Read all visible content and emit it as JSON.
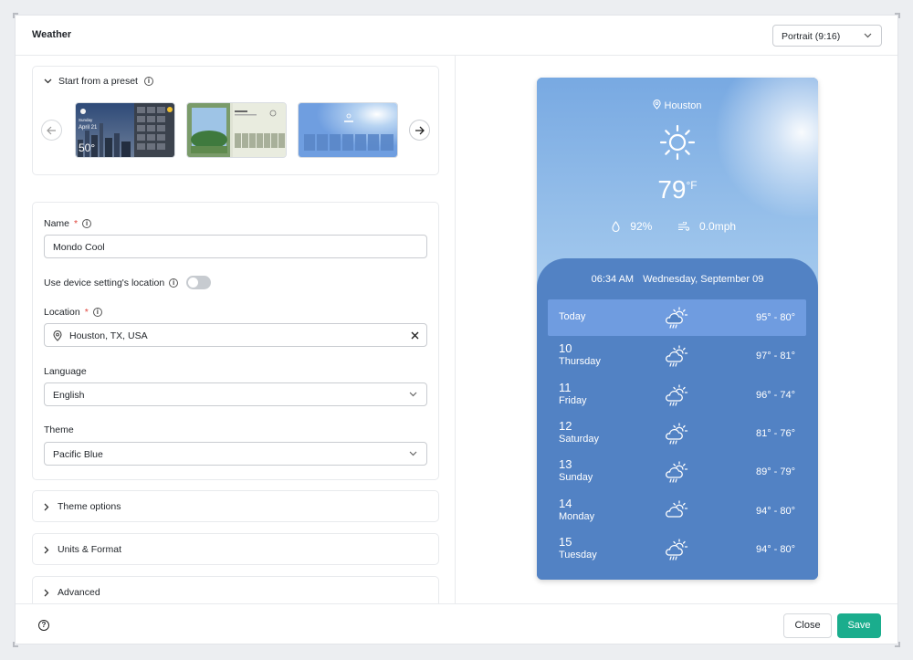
{
  "header": {
    "title": "Weather",
    "orientation": "Portrait (9:16)"
  },
  "preset": {
    "title": "Start from a preset",
    "thumb1_day": "Sunday",
    "thumb1_date": "April 21",
    "thumb1_temp": "50°"
  },
  "form": {
    "name_label": "Name",
    "required_mark": "*",
    "name_value": "Mondo Cool",
    "device_location_label": "Use device setting's location",
    "device_location_on": false,
    "location_label": "Location",
    "location_value": "Houston, TX, USA",
    "language_label": "Language",
    "language_value": "English",
    "theme_label": "Theme",
    "theme_value": "Pacific Blue"
  },
  "sections": [
    "Theme options",
    "Units & Format",
    "Advanced"
  ],
  "preview": {
    "location": "Houston",
    "temp": "79",
    "temp_unit": "°F",
    "humidity": "92%",
    "wind": "0.0mph",
    "time": "06:34 AM",
    "date": "Wednesday, September 09",
    "forecast": [
      {
        "num": "",
        "day": "Today",
        "range": "95° - 80°",
        "icon": "sun-cloud-rain-icon"
      },
      {
        "num": "10",
        "day": "Thursday",
        "range": "97° - 81°",
        "icon": "sun-cloud-rain-icon"
      },
      {
        "num": "11",
        "day": "Friday",
        "range": "96° - 74°",
        "icon": "sun-cloud-rain-icon"
      },
      {
        "num": "12",
        "day": "Saturday",
        "range": "81° - 76°",
        "icon": "sun-cloud-rain-icon"
      },
      {
        "num": "13",
        "day": "Sunday",
        "range": "89° - 79°",
        "icon": "sun-cloud-rain-icon"
      },
      {
        "num": "14",
        "day": "Monday",
        "range": "94° - 80°",
        "icon": "sun-cloud-icon"
      },
      {
        "num": "15",
        "day": "Tuesday",
        "range": "94° - 80°",
        "icon": "sun-cloud-rain-icon"
      }
    ]
  },
  "footer": {
    "close": "Close",
    "save": "Save"
  },
  "colors": {
    "accent": "#1aad8d",
    "preview_blue": "#5282c4",
    "today_highlight": "#6f9ce0",
    "required": "#e0453c"
  }
}
